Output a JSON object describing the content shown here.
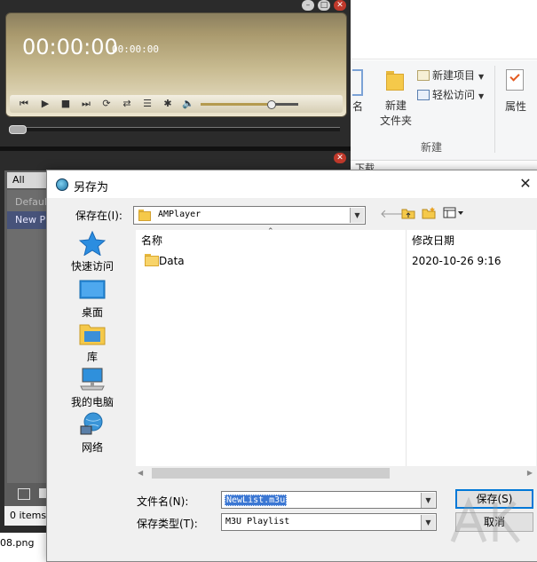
{
  "explorer": {
    "partial_label": "名",
    "new_folder_label": "新建\n文件夹",
    "new_item_label": "新建项目",
    "easy_access_label": "轻松访问",
    "group_label": "新建",
    "properties_label": "属性",
    "strip_text": "下载"
  },
  "amplayer": {
    "time_main": "00:00:00",
    "time_secondary": "00:00:00",
    "volume_fraction": 0.72,
    "seek_fraction": 0.0
  },
  "playlist": {
    "tab_label": "All Playlists",
    "items": [
      "Default",
      "New Playlist"
    ],
    "status": "0 items",
    "below_filename": "08.png"
  },
  "dialog": {
    "title": "另存为",
    "save_in_label": "保存在(I):",
    "save_in_value": "AMPlayer",
    "places": [
      "快速访问",
      "桌面",
      "库",
      "我的电脑",
      "网络"
    ],
    "columns": {
      "name": "名称",
      "date": "修改日期"
    },
    "files": [
      {
        "name": "Data",
        "date": "2020-10-26 9:16"
      }
    ],
    "file_name_label": "文件名(N):",
    "file_name_value": "NewList.m3u",
    "file_type_label": "保存类型(T):",
    "file_type_value": "M3U Playlist",
    "save_button": "保存(S)",
    "cancel_button": "取消"
  },
  "colors": {
    "selection": "#3b77d3",
    "playlist_selected": "#47537a",
    "close_red": "#c0392b"
  }
}
